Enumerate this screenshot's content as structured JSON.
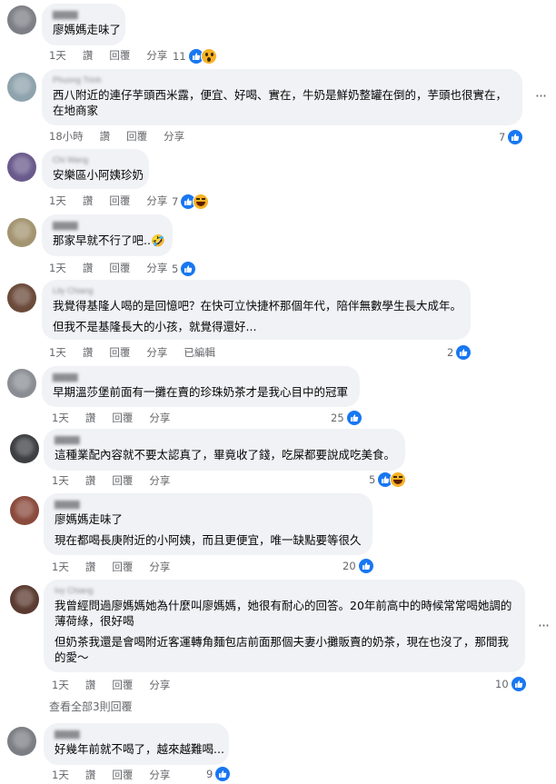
{
  "actions": {
    "like": "讚",
    "reply": "回覆",
    "share": "分享",
    "edited": "已編輯",
    "more": "···"
  },
  "view_replies": "查看全部3則回覆",
  "colors": {
    "like_blue": "#1877f2",
    "bubble_bg": "#f0f2f5",
    "meta_gray": "#65676b"
  },
  "comments": [
    {
      "author": "▇▇▇▇",
      "lines": [
        "廖媽媽走味了"
      ],
      "time": "1天",
      "reactions": "11",
      "emojis": [
        "like",
        "wow"
      ]
    },
    {
      "author": "Phuong Trinh",
      "lines": [
        "西八附近的連仔芋頭西米露，便宜、好喝、實在，牛奶是鮮奶整罐在倒的，芋頭也很實在，",
        "在地商家"
      ],
      "time": "18小時",
      "reactions": "7",
      "emojis": [
        "like"
      ]
    },
    {
      "author": "Chi Wang",
      "lines": [
        "安樂區小阿姨珍奶"
      ],
      "time": "1天",
      "reactions": "7",
      "emojis": [
        "like",
        "haha"
      ]
    },
    {
      "author": "▇▇▇▇",
      "lines": [
        "那家早就不行了吧..🤣"
      ],
      "time": "1天",
      "reactions": "5",
      "emojis": [
        "like"
      ]
    },
    {
      "author": "Lily Chiang",
      "lines": [
        "我覺得基隆人喝的是回憶吧？在快可立快捷杯那個年代，陪伴無數學生長大成年。",
        "但我不是基隆長大的小孩，就覺得還好..."
      ],
      "time": "1天",
      "reactions": "2",
      "emojis": [
        "like"
      ],
      "edited": true
    },
    {
      "author": "▇▇▇▇",
      "lines": [
        "早期溫莎堡前面有一攤在賣的珍珠奶茶才是我心目中的冠軍"
      ],
      "time": "1天",
      "reactions": "25",
      "emojis": [
        "like"
      ]
    },
    {
      "author": "▇▇▇▇",
      "lines": [
        "這種業配內容就不要太認真了，畢竟收了錢，吃屎都要說成吃美食。"
      ],
      "time": "1天",
      "reactions": "5",
      "emojis": [
        "like",
        "haha"
      ]
    },
    {
      "author": "▇▇▇▇",
      "lines": [
        "廖媽媽走味了",
        "現在都喝長庚附近的小阿姨，而且更便宜，唯一缺點要等很久"
      ],
      "time": "1天",
      "reactions": "20",
      "emojis": [
        "like"
      ]
    },
    {
      "author": "Ivy Chiang",
      "lines": [
        "我曾經問過廖媽媽她為什麼叫廖媽媽，她很有耐心的回答。20年前高中的時候常常喝她調的",
        "薄荷綠，很好喝",
        "但奶茶我還是會喝附近客運轉角麵包店前面那個夫妻小攤販賣的奶茶，現在也沒了，那間我",
        "的愛～"
      ],
      "time": "1天",
      "reactions": "10",
      "emojis": [
        "like"
      ]
    },
    {
      "author": "▇▇▇▇",
      "lines": [
        "好幾年前就不喝了，越來越難喝..."
      ],
      "time": "1天",
      "reactions": "9",
      "emojis": [
        "like"
      ]
    }
  ]
}
